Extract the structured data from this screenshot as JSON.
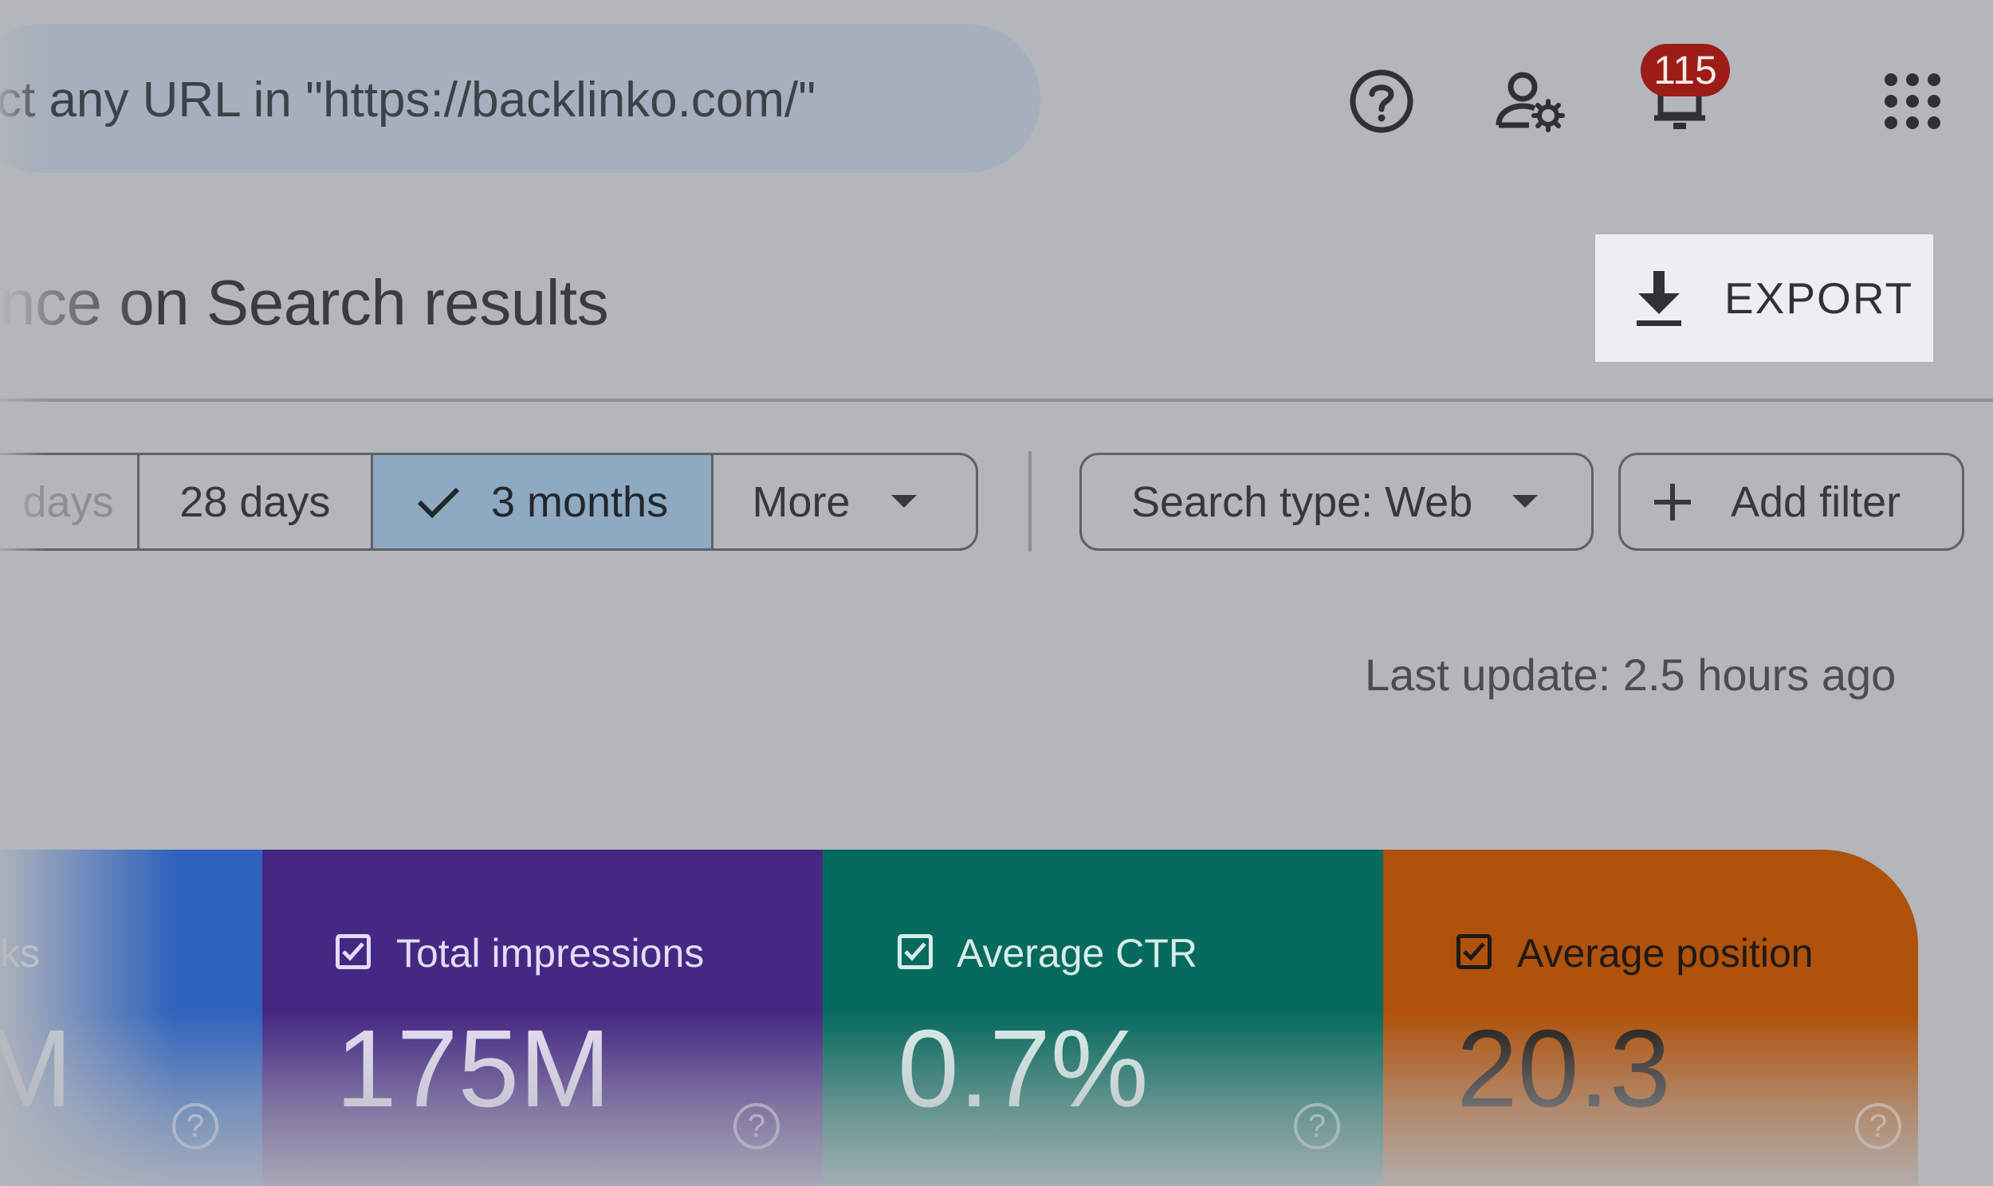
{
  "topbar": {
    "search_text": "ct any URL in \"https://backlinko.com/\"",
    "notifications_count": "115"
  },
  "header": {
    "title": "nce on Search results",
    "export_label": "EXPORT"
  },
  "filters": {
    "date_ranges": [
      {
        "label": "days",
        "selected": false
      },
      {
        "label": "28 days",
        "selected": false
      },
      {
        "label": "3 months",
        "selected": true
      },
      {
        "label": "More",
        "selected": false
      }
    ],
    "search_type_label": "Search type: Web",
    "add_filter_label": "Add filter"
  },
  "status": {
    "last_update": "Last update: 2.5 hours ago"
  },
  "metrics": [
    {
      "label": "ks",
      "value": "M",
      "color": "#2f63bd"
    },
    {
      "label": "Total impressions",
      "value": "175M",
      "color": "#452884"
    },
    {
      "label": "Average CTR",
      "value": "0.7%",
      "color": "#066a5d"
    },
    {
      "label": "Average position",
      "value": "20.3",
      "color": "#b0520b"
    }
  ],
  "colors": {
    "background": "#b3b6bb",
    "search_pill": "#a6afbd",
    "selected_segment": "#8ea9c2",
    "badge": "#9b1d16",
    "export_button": "#eceef1"
  }
}
